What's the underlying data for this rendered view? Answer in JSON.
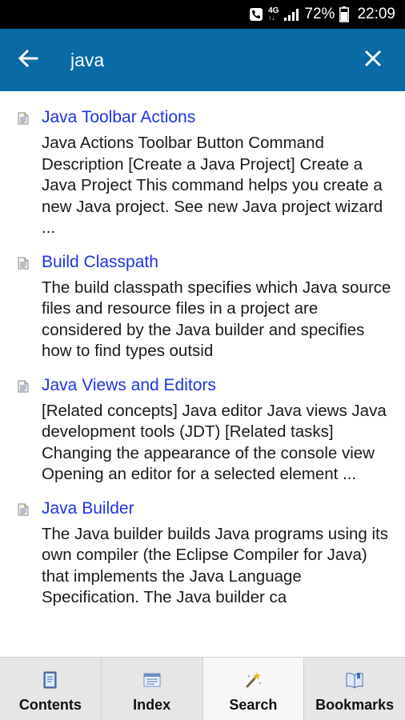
{
  "status_bar": {
    "network_top": "4G",
    "network_bottom": "↑↓",
    "battery": "72%",
    "time": "22:09"
  },
  "search": {
    "value": "java",
    "back_icon": "arrow-left-icon",
    "clear_icon": "close-icon"
  },
  "results": [
    {
      "title": "Java Toolbar Actions",
      "description": "Java Actions Toolbar Button Command Description [Create a Java Project] Create a Java Project This command helps you create a new Java project. See new Java project wizard ..."
    },
    {
      "title": "Build Classpath",
      "description": "The build classpath specifies which Java source files and resource files in a project are considered by the Java builder and specifies how to find types outsid"
    },
    {
      "title": "Java Views and Editors",
      "description": "[Related concepts] Java editor Java views Java development tools (JDT) [Related tasks] Changing the appearance of the console view Opening an editor for a selected element ..."
    },
    {
      "title": "Java Builder",
      "description": "The Java builder builds Java programs using its own compiler (the Eclipse Compiler for Java) that implements the Java Language Specification. The Java builder ca"
    }
  ],
  "tabs": [
    {
      "label": "Contents",
      "icon": "book-icon"
    },
    {
      "label": "Index",
      "icon": "index-list-icon"
    },
    {
      "label": "Search",
      "icon": "search-wand-icon",
      "active": true
    },
    {
      "label": "Bookmarks",
      "icon": "bookmark-book-icon"
    }
  ],
  "colors": {
    "app_bar": "#0a6aa6",
    "link": "#1d35e0",
    "status_bar": "#000000"
  }
}
